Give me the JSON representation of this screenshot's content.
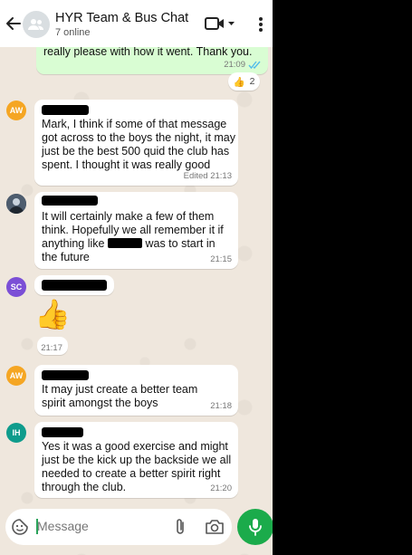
{
  "header": {
    "title": "HYR Team & Bus Chat",
    "subtitle": "7 online"
  },
  "messages": [
    {
      "id": "out-1",
      "direction": "outgoing",
      "text": "really please with how it went. Thank you.",
      "time": "21:09",
      "reaction": {
        "emoji": "👍",
        "count": "2"
      }
    },
    {
      "id": "aw-1",
      "avatar_initials": "AW",
      "avatar_color": "#f5a623",
      "text": "Mark, I think if some of that message got across to the boys the night, it may just be the best 500 quid the club has spent. I thought it was really good",
      "time": "Edited 21:13"
    },
    {
      "id": "photo-1",
      "text_before": "It will certainly make a few of them think. Hopefully we all remember it if anything like",
      "text_after": "was to start in the future",
      "time": "21:15"
    },
    {
      "id": "sc-1",
      "avatar_initials": "SC",
      "avatar_color": "#7b4fd6",
      "emoji": "👍",
      "time": "21:17"
    },
    {
      "id": "aw-2",
      "avatar_initials": "AW",
      "avatar_color": "#f5a623",
      "text": "It may just create a better team spirit amongst the boys",
      "time": "21:18"
    },
    {
      "id": "ih-1",
      "avatar_initials": "IH",
      "avatar_color": "#0f9c8c",
      "text": "Yes it was a good exercise and might just be the kick up the backside we all needed to create a better spirit right through the club.",
      "time": "21:20"
    }
  ],
  "composer": {
    "placeholder": "Message"
  },
  "colors": {
    "accent_green": "#1bab4b",
    "outgoing_bubble": "#d9fdd3",
    "chat_background": "#efe7dd"
  },
  "icons": [
    "back-arrow-icon",
    "group-icon",
    "video-call-icon",
    "dropdown-icon",
    "more-vert-icon",
    "double-check-icon",
    "emoji-sticker-icon",
    "attach-icon",
    "camera-icon",
    "mic-icon"
  ]
}
